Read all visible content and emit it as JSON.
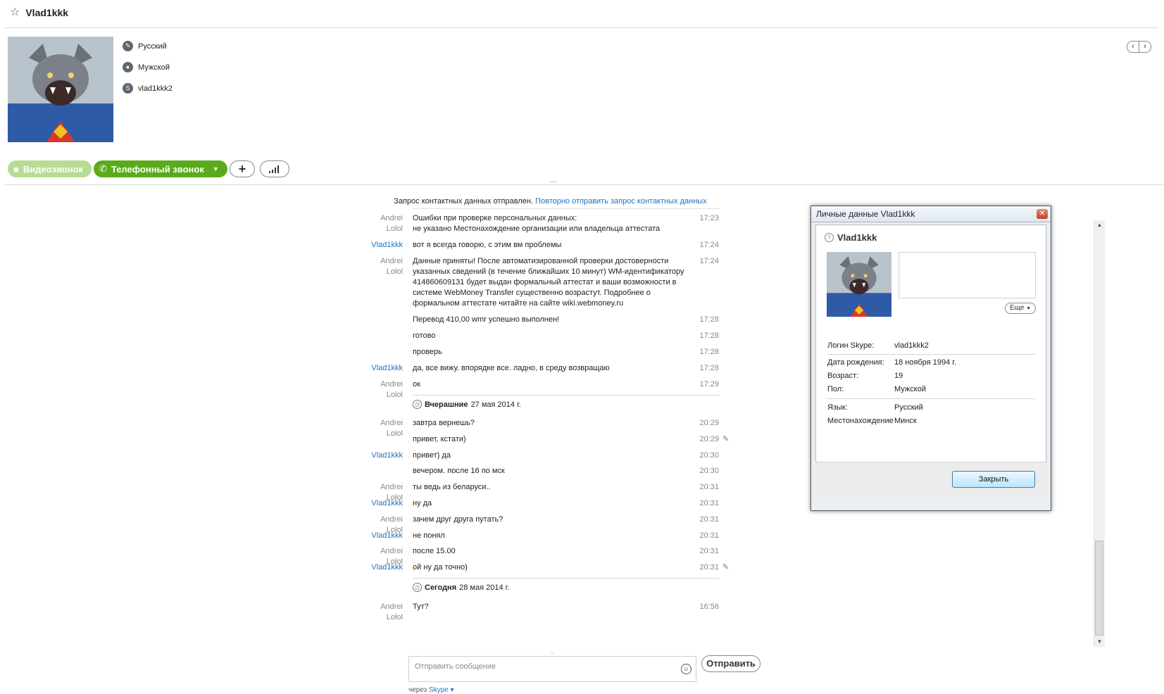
{
  "header": {
    "contact_name": "Vlad1kkk"
  },
  "profile": {
    "language": "Русский",
    "gender": "Мужской",
    "skype_name": "vlad1kkk2"
  },
  "actions": {
    "video_call": "Видеозвонок",
    "phone_call": "Телефонный звонок",
    "add_symbol": "+"
  },
  "notice": {
    "text": "Запрос контактных данных отправлен.",
    "link": "Повторно отправить запрос контактных данных"
  },
  "chat": {
    "messages": [
      {
        "sender": "Andrei Lolol",
        "text": "Ошибки при проверке персональных данных:\nне указано Местонахождение организации или владельца аттестата",
        "time": "17:23"
      },
      {
        "sender": "Vlad1kkk",
        "text": "вот я всегда говорю, с этим вм проблемы",
        "time": "17:24"
      },
      {
        "sender": "Andrei Lolol",
        "text": "Данные приняты! После автоматизированной проверки достоверности указанных сведений (в течение ближайших 10 минут) WM-идентификатору 414860609131 будет выдан формальный аттестат и ваши возможности в системе WebMoney Transfer существенно возрастут. Подробнее о формальном аттестате читайте на сайте wiki.webmoney.ru",
        "time": "17:24"
      },
      {
        "sender": "",
        "text": "Перевод 410,00 wmr успешно выполнен!",
        "time": "17:28"
      },
      {
        "sender": "",
        "text": "готово",
        "time": "17:28"
      },
      {
        "sender": "",
        "text": "проверь",
        "time": "17:28"
      },
      {
        "sender": "Vlad1kkk",
        "text": "да, все вижу. впорядке все. ладно, в среду возвращаю",
        "time": "17:28"
      },
      {
        "sender": "Andrei Lolol",
        "text": "ок",
        "time": "17:29"
      }
    ],
    "day_yesterday": {
      "label": "Вчерашние",
      "date": "27 мая 2014 г."
    },
    "messages2": [
      {
        "sender": "Andrei Lolol",
        "text": "завтра вернешь?",
        "time": "20:29"
      },
      {
        "sender": "",
        "text": "привет, кстати)",
        "time": "20:29"
      },
      {
        "sender": "Vlad1kkk",
        "text": "привет) да",
        "time": "20:30"
      },
      {
        "sender": "",
        "text": "вечером. после 16 по мск",
        "time": "20:30"
      },
      {
        "sender": "Andrei Lolol",
        "text": "ты ведь из беларуси..",
        "time": "20:31"
      },
      {
        "sender": "Vlad1kkk",
        "text": "ну да",
        "time": "20:31"
      },
      {
        "sender": "Andrei Lolol",
        "text": "зачем друг друга путать?",
        "time": "20:31"
      },
      {
        "sender": "Vlad1kkk",
        "text": "не понял",
        "time": "20:31"
      },
      {
        "sender": "Andrei Lolol",
        "text": "после 15.00",
        "time": "20:31"
      },
      {
        "sender": "Vlad1kkk",
        "text": "ой ну да точно)",
        "time": "20:31"
      }
    ],
    "day_today": {
      "label": "Сегодня",
      "date": "28 мая 2014 г."
    },
    "messages3": [
      {
        "sender": "Andrei Lolol",
        "text": "Тут?",
        "time": "16:56"
      }
    ]
  },
  "composer": {
    "placeholder": "Отправить сообщение",
    "send_label": "Отправить",
    "via_prefix": "через",
    "via_service": "Skype"
  },
  "dialog": {
    "title": "Личные данные Vlad1kkk",
    "name": "Vlad1kkk",
    "more_label": "Еще",
    "fields": {
      "login_label": "Логин Skype:",
      "login_value": "vlad1kkk2",
      "birth_label": "Дата рождения:",
      "birth_value": "18 ноября 1994 г.",
      "age_label": "Возраст:",
      "age_value": "19",
      "gender_label": "Пол:",
      "gender_value": "Мужской",
      "lang_label": "Язык:",
      "lang_value": "Русский",
      "loc_label": "Местонахождение",
      "loc_value": "Минск"
    },
    "close_label": "Закрыть"
  },
  "colors": {
    "accent_green": "#5aab1a",
    "link_blue": "#1a73c8"
  }
}
